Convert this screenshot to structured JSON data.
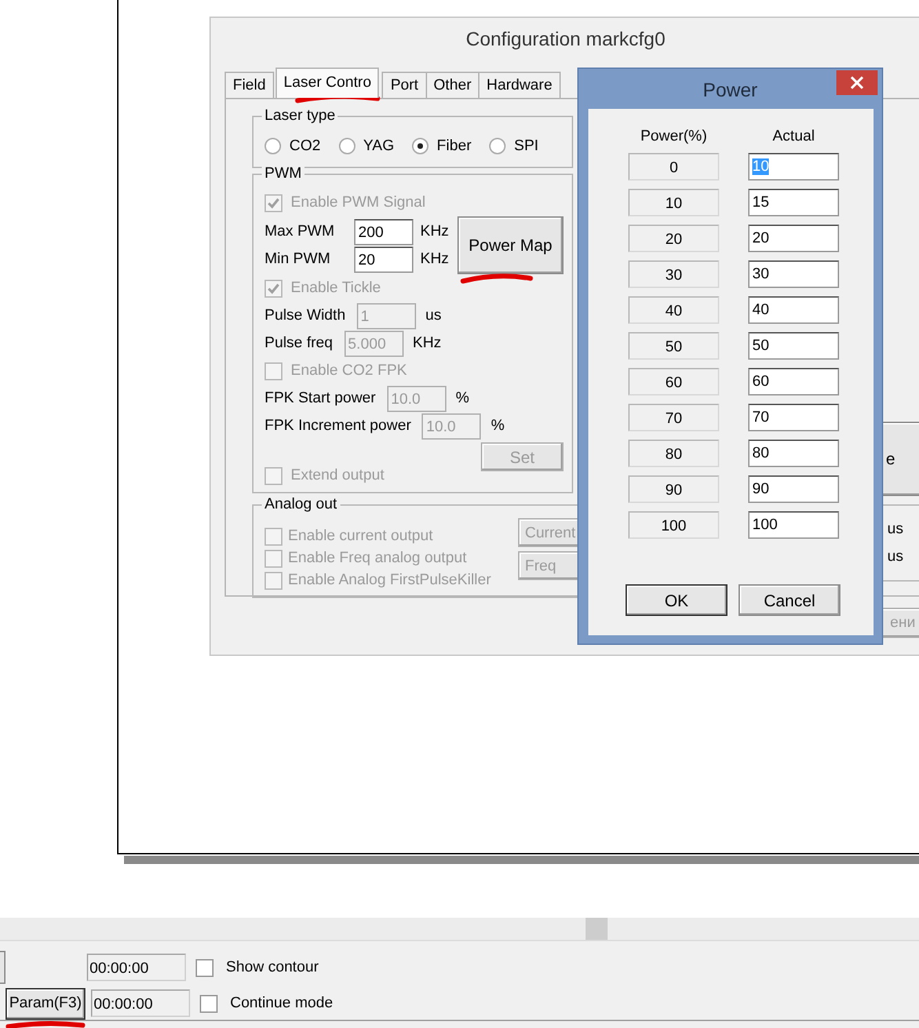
{
  "config_dialog": {
    "title": "Configuration markcfg0",
    "tabs": [
      {
        "label": "Field",
        "selected": false
      },
      {
        "label": "Laser Contro",
        "selected": true
      },
      {
        "label": "Port",
        "selected": false
      },
      {
        "label": "Other",
        "selected": false
      },
      {
        "label": "Hardware",
        "selected": false
      }
    ],
    "laser_type": {
      "label": "Laser type",
      "options": [
        {
          "label": "CO2",
          "selected": false
        },
        {
          "label": "YAG",
          "selected": false
        },
        {
          "label": "Fiber",
          "selected": true
        },
        {
          "label": "SPI",
          "selected": false
        }
      ]
    },
    "pwm": {
      "label": "PWM",
      "enable_pwm": {
        "label": "Enable PWM Signal",
        "checked": true,
        "disabled": true
      },
      "frequency_fields": [
        {
          "label": "Max PWM",
          "value": "200",
          "unit": "KHz"
        },
        {
          "label": "Min PWM",
          "value": "20",
          "unit": "KHz"
        }
      ],
      "power_map_button": "Power Map",
      "rows": [
        {
          "kind": "checkbox",
          "label": "Enable Tickle",
          "checked": true,
          "disabled": true
        },
        {
          "kind": "field",
          "label": "Pulse Width",
          "value": "1",
          "unit": "us",
          "disabled": true
        },
        {
          "kind": "field",
          "label": "Pulse freq",
          "value": "5.000",
          "unit": "KHz",
          "disabled": true
        },
        {
          "kind": "checkbox",
          "label": "Enable CO2 FPK",
          "checked": false,
          "disabled": true
        },
        {
          "kind": "field",
          "label": "FPK Start power",
          "value": "10.0",
          "unit": "%",
          "disabled": true
        },
        {
          "kind": "field",
          "label": "FPK Increment power",
          "value": "10.0",
          "unit": "%",
          "disabled": true
        }
      ],
      "set_button": {
        "label": "Set",
        "disabled": true
      },
      "extend_output": {
        "label": "Extend output",
        "checked": false,
        "disabled": true
      }
    },
    "analog_out": {
      "label": "Analog out",
      "options": [
        {
          "label": "Enable current output",
          "checked": false,
          "disabled": true
        },
        {
          "label": "Enable Freq analog output",
          "checked": false,
          "disabled": true
        },
        {
          "label": "Enable Analog FirstPulseKiller",
          "checked": false,
          "disabled": true
        }
      ],
      "buttons": [
        {
          "label": "Current",
          "disabled": true
        },
        {
          "label": "Freq",
          "disabled": true
        }
      ]
    },
    "partial_button": "e",
    "units": [
      "us",
      "us"
    ],
    "apply_button": "ени"
  },
  "power_dialog": {
    "title": "Power",
    "columns": [
      "Power(%)",
      "Actual"
    ],
    "rows": [
      {
        "power": "0",
        "actual": "10",
        "selected": true
      },
      {
        "power": "10",
        "actual": "15",
        "selected": false
      },
      {
        "power": "20",
        "actual": "20",
        "selected": false
      },
      {
        "power": "30",
        "actual": "30",
        "selected": false
      },
      {
        "power": "40",
        "actual": "40",
        "selected": false
      },
      {
        "power": "50",
        "actual": "50",
        "selected": false
      },
      {
        "power": "60",
        "actual": "60",
        "selected": false
      },
      {
        "power": "70",
        "actual": "70",
        "selected": false
      },
      {
        "power": "80",
        "actual": "80",
        "selected": false
      },
      {
        "power": "90",
        "actual": "90",
        "selected": false
      },
      {
        "power": "100",
        "actual": "100",
        "selected": false
      }
    ],
    "buttons": [
      {
        "label": "OK",
        "default": true
      },
      {
        "label": "Cancel",
        "default": false
      }
    ]
  },
  "bottom_bar": {
    "rows": [
      {
        "button": null,
        "time": "00:00:00",
        "option": {
          "label": "Show contour",
          "checked": false
        }
      },
      {
        "button": "Param(F3)",
        "time": "00:00:00",
        "option": {
          "label": "Continue mode",
          "checked": false
        }
      }
    ]
  }
}
